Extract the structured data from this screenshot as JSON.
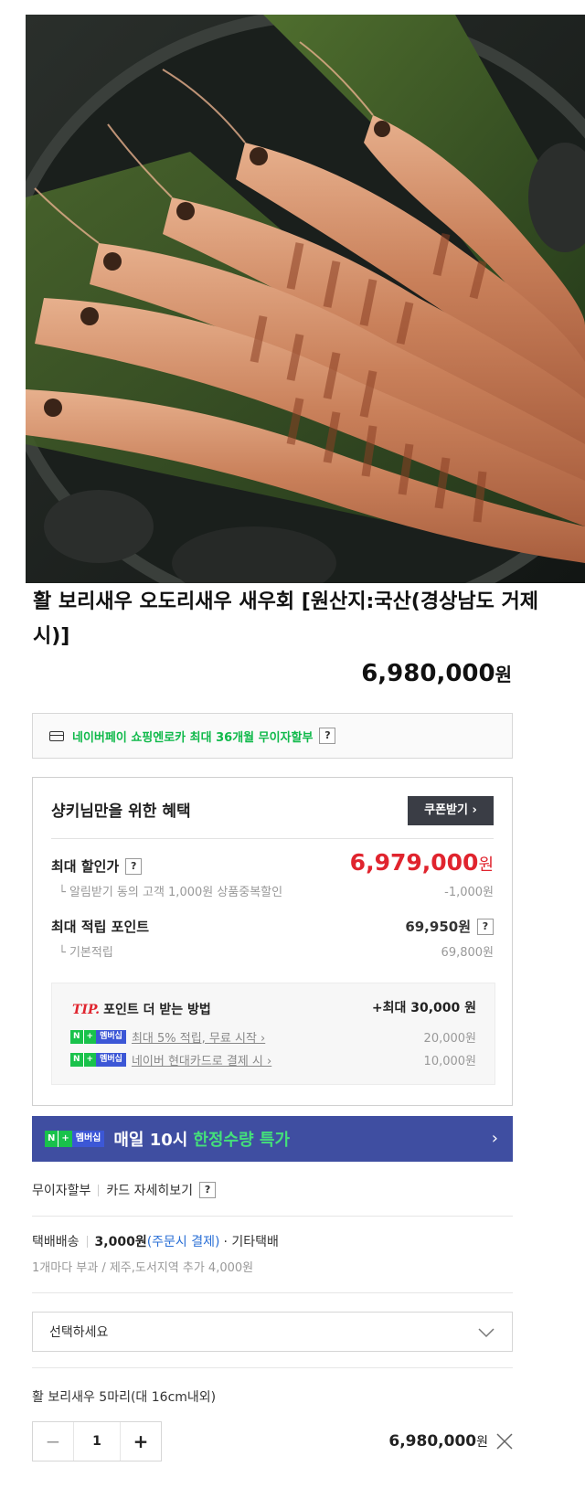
{
  "product": {
    "title": "활 보리새우 오도리새우 새우회 [원산지:국산(경상남도 거제시)]",
    "price": "6,980,000",
    "price_unit": "원"
  },
  "npay": {
    "text": "네이버페이 쇼핑엔로카 최대 36개월 무이자할부",
    "help": "?"
  },
  "benefit": {
    "title": "샹키님만을 위한 혜택",
    "coupon_button": "쿠폰받기 ›",
    "max_discount_label": "최대 할인가",
    "max_discount_help": "?",
    "max_discount_price": "6,979,000",
    "max_discount_unit": "원",
    "alert_sub_label": "└ 알림받기 동의 고객 1,000원 상품중복할인",
    "alert_sub_value": "-1,000원",
    "points_label": "최대 적립 포인트",
    "points_value": "69,950원",
    "points_help": "?",
    "basic_sub_label": "└ 기본적립",
    "basic_sub_value": "69,800원",
    "tip": {
      "tip_word": "TIP.",
      "heading": "포인트 더 받는 방법",
      "max": "+최대 30,000 원",
      "rows": [
        {
          "text": "최대 5% 적립, 무료 시작 ›",
          "value": "20,000원"
        },
        {
          "text": "네이버 현대카드로 결제 시 ›",
          "value": "10,000원"
        }
      ]
    }
  },
  "membership_badge": {
    "n": "N",
    "plus": "+",
    "member": "멤버십"
  },
  "banner": {
    "text": "매일 10시",
    "highlight": "한정수량 특가",
    "arrow": "›"
  },
  "installment": {
    "label": "무이자할부",
    "details": "카드 자세히보기",
    "help": "?"
  },
  "shipping": {
    "type": "택배배송",
    "fee": "3,000원",
    "pay_note": "(주문시 결제)",
    "extra": "· 기타택배",
    "note": "1개마다 부과 / 제주,도서지역 추가 4,000원"
  },
  "option_select": {
    "placeholder": "선택하세요"
  },
  "selected_option": {
    "name": "활 보리새우 5마리(대 16cm내외)",
    "minus": "−",
    "quantity": "1",
    "plus": "+",
    "total": "6,980,000",
    "total_unit": "원"
  },
  "colors": {
    "discount_red": "#e0242e",
    "naver_green": "#0fb94a",
    "banner_blue": "#3f4ea1"
  },
  "icons": [
    "card-icon",
    "chevron-down-icon",
    "close-icon",
    "membership-badge-icon"
  ]
}
